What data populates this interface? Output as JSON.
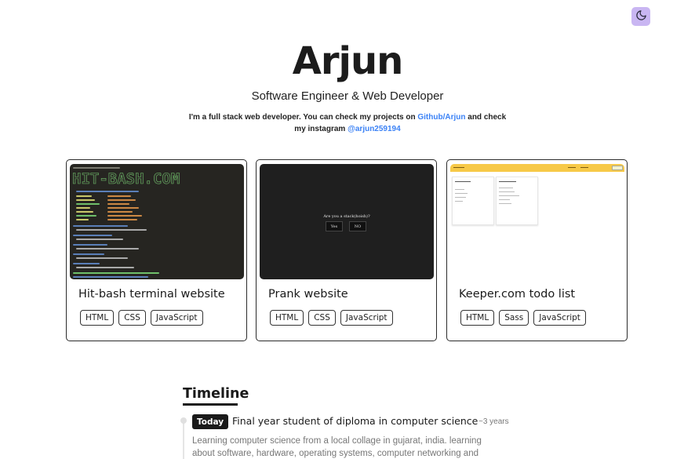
{
  "header": {
    "theme_toggle_icon": "moon-icon",
    "accent_color": "#c9b6f2"
  },
  "hero": {
    "name": "Arjun",
    "role": "Software Engineer & Web Developer",
    "intro_prefix": "I'm a full stack web developer. You can check my projects on ",
    "github_link": "Github/Arjun",
    "intro_middle": " and check my instagram ",
    "instagram_link": "@arjun259194",
    "link_color": "#3b82f6"
  },
  "projects": [
    {
      "title": "Hit-bash terminal website",
      "thumbnail_logo": "HIT-BASH.COM",
      "tags": [
        "HTML",
        "CSS",
        "JavaScript"
      ]
    },
    {
      "title": "Prank website",
      "thumbnail_question": "Are you a stack(hoish)?",
      "thumbnail_yes": "Yes",
      "thumbnail_no": "NO",
      "tags": [
        "HTML",
        "CSS",
        "JavaScript"
      ]
    },
    {
      "title": "Keeper.com todo list",
      "tags": [
        "HTML",
        "Sass",
        "JavaScript"
      ]
    }
  ],
  "timeline": {
    "heading": "Timeline",
    "entries": [
      {
        "badge": "Today",
        "title": "Final year student of diploma in computer science",
        "age": "~3 years",
        "description": "Learning computer science from a local collage in gujarat, india. learning about software, hardware, operating systems, computer networking and"
      }
    ]
  }
}
